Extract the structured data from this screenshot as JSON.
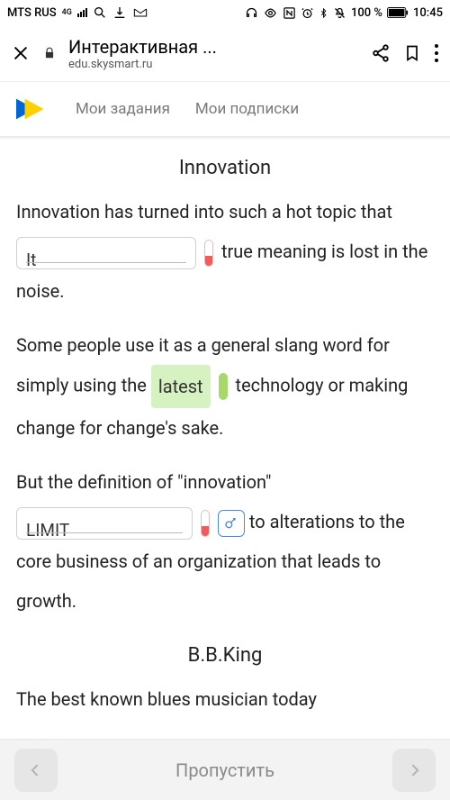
{
  "status": {
    "carrier": "MTS RUS",
    "net": "4G",
    "battery": "100 %",
    "time": "10:45"
  },
  "browser": {
    "title": "Интерактивная ...",
    "url": "edu.skysmart.ru"
  },
  "header": {
    "tab1": "Мои задания",
    "tab2": "Мои подписки"
  },
  "content": {
    "h_innovation": "Innovation",
    "p1_a": "Innovation has turned into such a hot topic that ",
    "blank1": "It",
    "p1_b": " true meaning is lost in the noise.",
    "p2_a": "Some people use it as a general slang word for simply using the ",
    "blank2": "latest",
    "p2_b": " technology or making change for change's sake.",
    "p3_a": "But the definition of \"innovation\" ",
    "blank3": "LIMIT",
    "p3_b": " to alterations to the core business of an organization that leads to growth.",
    "h_bbking": "B.B.King",
    "p4": "The best known blues musician today"
  },
  "bottom": {
    "skip": "Пропустить"
  }
}
